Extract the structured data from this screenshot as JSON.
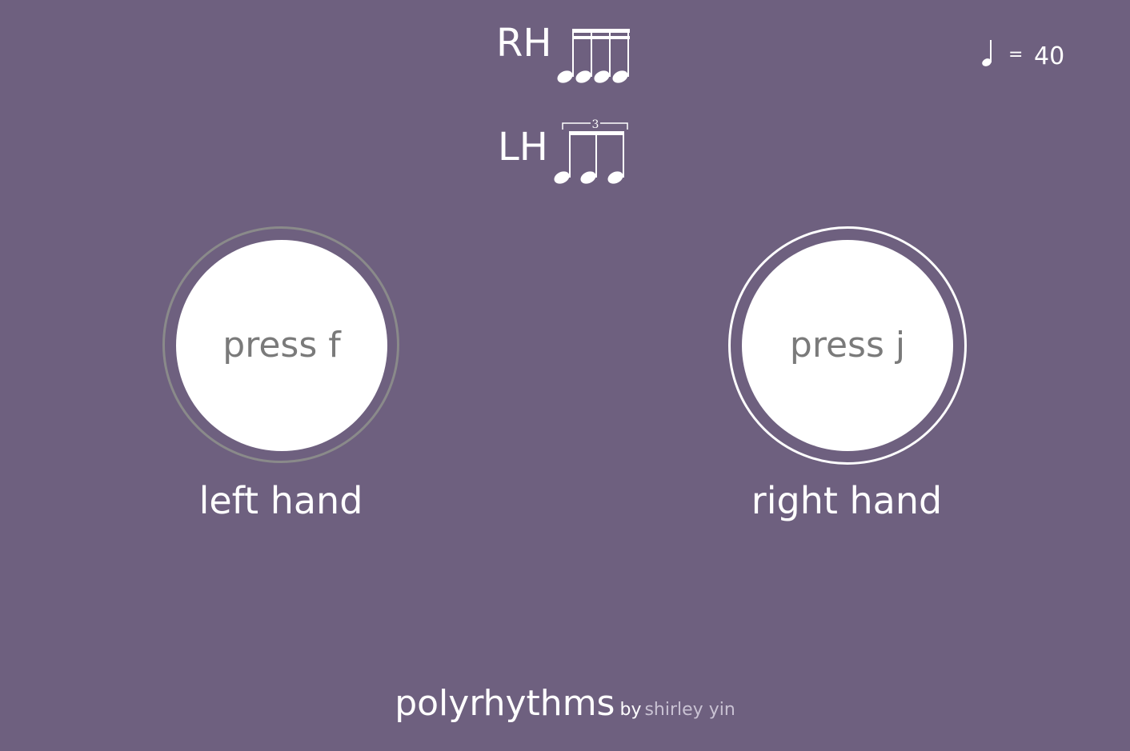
{
  "rhythms": {
    "right": {
      "label": "RH",
      "notes": 4,
      "tuplet": ""
    },
    "left": {
      "label": "LH",
      "notes": 3,
      "tuplet": "3"
    }
  },
  "tempo": {
    "note_icon": "quarter-note-icon",
    "equals": "=",
    "bpm": "40"
  },
  "pads": {
    "left": {
      "prompt": "press f",
      "caption": "left hand",
      "ring_color": "#8a8a8a"
    },
    "right": {
      "prompt": "press j",
      "caption": "right hand",
      "ring_color": "#ffffff"
    }
  },
  "footer": {
    "title": "polyrhythms",
    "by": "by",
    "author": "shirley yin"
  },
  "colors": {
    "background": "#6e607f",
    "pad": "#ffffff",
    "prompt_text": "#7a7a7a"
  }
}
